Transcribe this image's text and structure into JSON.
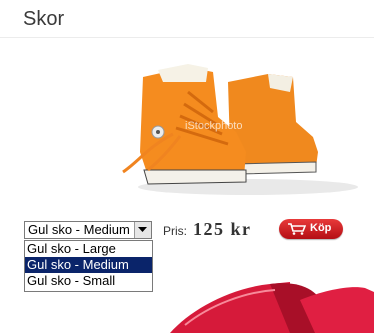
{
  "page": {
    "title": "Skor"
  },
  "product": {
    "image_desc": "orange-high-top-sneakers",
    "watermark": "iStockphoto",
    "variant_select": {
      "selected": "Gul sko - Medium",
      "options": [
        "Gul sko - Large",
        "Gul sko - Medium",
        "Gul sko - Small"
      ],
      "selected_index": 1
    },
    "price_label": "Pris:",
    "price_value": "125 kr",
    "buy_label": "Köp"
  },
  "colors": {
    "accent": "#c8161d",
    "selection": "#0a246a"
  }
}
